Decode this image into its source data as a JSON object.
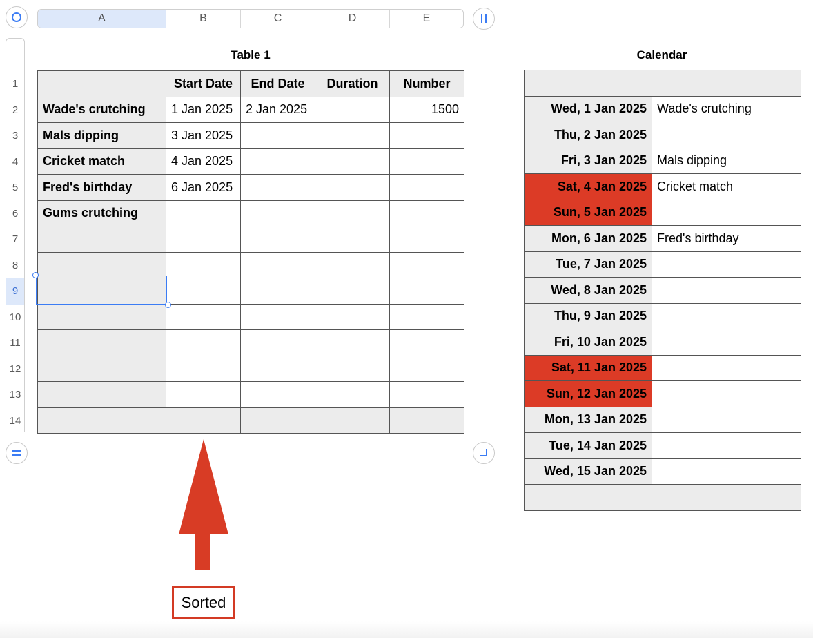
{
  "columns": [
    "A",
    "B",
    "C",
    "D",
    "E"
  ],
  "rows": [
    "1",
    "2",
    "3",
    "4",
    "5",
    "6",
    "7",
    "8",
    "9",
    "10",
    "11",
    "12",
    "13",
    "14"
  ],
  "selected_row": "9",
  "selected_column": "A",
  "table1": {
    "title": "Table 1",
    "headers": [
      "",
      "Start Date",
      "End Date",
      "Duration",
      "Number"
    ],
    "body": [
      [
        "Wade's crutching",
        "1 Jan 2025",
        "2 Jan 2025",
        "",
        "1500"
      ],
      [
        "Mals dipping",
        "3 Jan 2025",
        "",
        "",
        ""
      ],
      [
        "Cricket match",
        "4 Jan 2025",
        "",
        "",
        ""
      ],
      [
        "Fred's birthday",
        "6 Jan 2025",
        "",
        "",
        ""
      ],
      [
        "Gums crutching",
        "",
        "",
        "",
        ""
      ]
    ]
  },
  "calendar": {
    "title": "Calendar",
    "rows": [
      {
        "date": "Wed, 1 Jan 2025",
        "event": "Wade's crutching",
        "weekend": false
      },
      {
        "date": "Thu, 2 Jan 2025",
        "event": "",
        "weekend": false
      },
      {
        "date": "Fri, 3 Jan 2025",
        "event": "Mals dipping",
        "weekend": false
      },
      {
        "date": "Sat, 4 Jan 2025",
        "event": "Cricket match",
        "weekend": true
      },
      {
        "date": "Sun, 5 Jan 2025",
        "event": "",
        "weekend": true
      },
      {
        "date": "Mon, 6 Jan 2025",
        "event": "Fred's birthday",
        "weekend": false
      },
      {
        "date": "Tue, 7 Jan 2025",
        "event": "",
        "weekend": false
      },
      {
        "date": "Wed, 8 Jan 2025",
        "event": "",
        "weekend": false
      },
      {
        "date": "Thu, 9 Jan 2025",
        "event": "",
        "weekend": false
      },
      {
        "date": "Fri, 10 Jan 2025",
        "event": "",
        "weekend": false
      },
      {
        "date": "Sat, 11 Jan 2025",
        "event": "",
        "weekend": true
      },
      {
        "date": "Sun, 12 Jan 2025",
        "event": "",
        "weekend": true
      },
      {
        "date": "Mon, 13 Jan 2025",
        "event": "",
        "weekend": false
      },
      {
        "date": "Tue, 14 Jan 2025",
        "event": "",
        "weekend": false
      },
      {
        "date": "Wed, 15 Jan 2025",
        "event": "",
        "weekend": false
      }
    ]
  },
  "annotation": {
    "label": "Sorted",
    "color": "#d33a24"
  },
  "colors": {
    "weekend_fill": "#dc3b26",
    "selection": "#3b7cf4",
    "header_fill": "#ececec"
  }
}
